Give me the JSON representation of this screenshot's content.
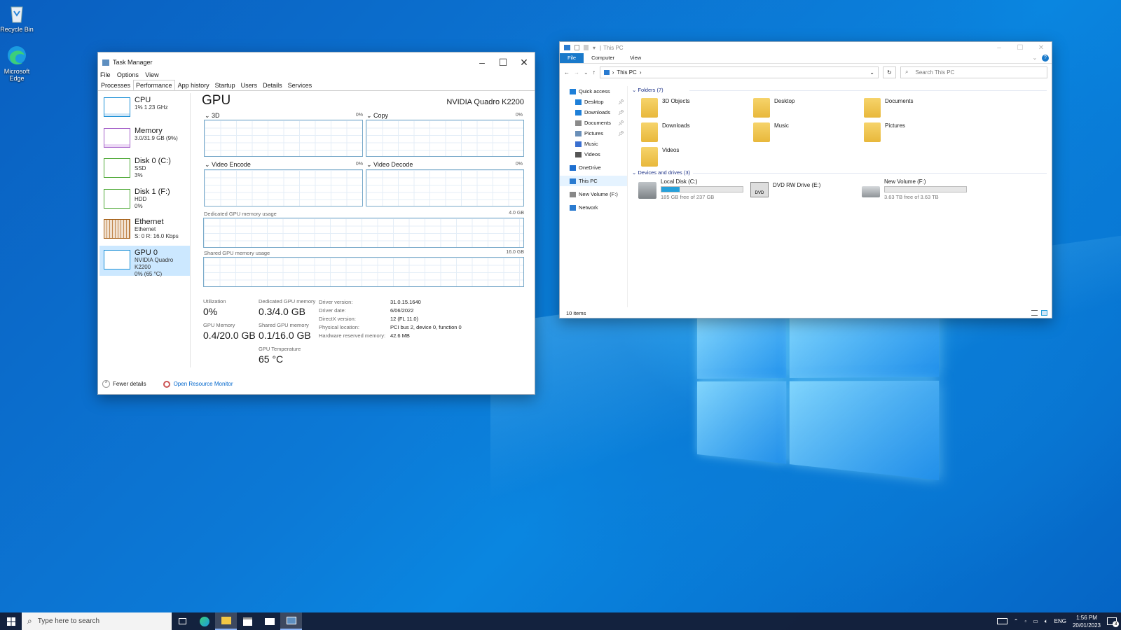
{
  "desktop": {
    "icons": [
      {
        "label": "Recycle Bin"
      },
      {
        "label": "Microsoft Edge"
      }
    ]
  },
  "task_manager": {
    "title": "Task Manager",
    "menu": [
      "File",
      "Options",
      "View"
    ],
    "tabs": [
      "Processes",
      "Performance",
      "App history",
      "Startup",
      "Users",
      "Details",
      "Services"
    ],
    "active_tab": "Performance",
    "resources": [
      {
        "name": "CPU",
        "sub1": "1% 1.23 GHz",
        "sub2": "",
        "color": "#1a8fd6"
      },
      {
        "name": "Memory",
        "sub1": "3.0/31.9 GB (9%)",
        "sub2": "",
        "color": "#a35ec8"
      },
      {
        "name": "Disk 0 (C:)",
        "sub1": "SSD",
        "sub2": "3%",
        "color": "#4da835"
      },
      {
        "name": "Disk 1 (F:)",
        "sub1": "HDD",
        "sub2": "0%",
        "color": "#4da835"
      },
      {
        "name": "Ethernet",
        "sub1": "Ethernet",
        "sub2": "S: 0 R: 16.0 Kbps",
        "color": "#a7631b"
      },
      {
        "name": "GPU 0",
        "sub1": "NVIDIA Quadro K2200",
        "sub2": "0% (65 °C)",
        "color": "#1a8fd6"
      }
    ],
    "gpu": {
      "heading": "GPU",
      "model": "NVIDIA Quadro K2200",
      "engines": [
        {
          "label": "3D",
          "pct": "0%"
        },
        {
          "label": "Copy",
          "pct": "0%"
        },
        {
          "label": "Video Encode",
          "pct": "0%"
        },
        {
          "label": "Video Decode",
          "pct": "0%"
        }
      ],
      "dedicated_label": "Dedicated GPU memory usage",
      "dedicated_max": "4.0 GB",
      "shared_label": "Shared GPU memory usage",
      "shared_max": "16.0 GB",
      "stats": [
        {
          "label": "Utilization",
          "value": "0%"
        },
        {
          "label": "Dedicated GPU memory",
          "value": "0.3/4.0 GB"
        },
        {
          "label": "GPU Memory",
          "value": "0.4/20.0 GB"
        },
        {
          "label": "Shared GPU memory",
          "value": "0.1/16.0 GB"
        },
        {
          "label": "GPU Temperature",
          "value": "65 °C"
        }
      ],
      "props": [
        {
          "k": "Driver version:",
          "v": "31.0.15.1640"
        },
        {
          "k": "Driver date:",
          "v": "6/06/2022"
        },
        {
          "k": "DirectX version:",
          "v": "12 (FL 11.0)"
        },
        {
          "k": "Physical location:",
          "v": "PCI bus 2, device 0, function 0"
        },
        {
          "k": "Hardware reserved memory:",
          "v": "42.6 MB"
        }
      ]
    },
    "footer": {
      "fewer": "Fewer details",
      "monitor": "Open Resource Monitor"
    }
  },
  "explorer": {
    "title": "This PC",
    "ribbon": [
      "File",
      "Computer",
      "View"
    ],
    "path": "This PC",
    "search_placeholder": "Search This PC",
    "nav": [
      {
        "label": "Quick access",
        "indent": 0
      },
      {
        "label": "Desktop",
        "indent": 1,
        "pin": true
      },
      {
        "label": "Downloads",
        "indent": 1,
        "pin": true
      },
      {
        "label": "Documents",
        "indent": 1,
        "pin": true
      },
      {
        "label": "Pictures",
        "indent": 1,
        "pin": true
      },
      {
        "label": "Music",
        "indent": 1
      },
      {
        "label": "Videos",
        "indent": 1
      },
      {
        "label": "OneDrive",
        "indent": 0
      },
      {
        "label": "This PC",
        "indent": 0,
        "selected": true
      },
      {
        "label": "New Volume (F:)",
        "indent": 0
      },
      {
        "label": "Network",
        "indent": 0
      }
    ],
    "folders_header": "Folders (7)",
    "folders": [
      "3D Objects",
      "Desktop",
      "Documents",
      "Downloads",
      "Music",
      "Pictures",
      "Videos"
    ],
    "drives_header": "Devices and drives (3)",
    "drives": [
      {
        "name": "Local Disk (C:)",
        "free": "185 GB free of 237 GB",
        "used_fraction": 0.22
      },
      {
        "name": "DVD RW Drive (E:)",
        "free": "",
        "used_fraction": null
      },
      {
        "name": "New Volume (F:)",
        "free": "3.63 TB free of 3.63 TB",
        "used_fraction": 0.0
      }
    ],
    "status": "10 items"
  },
  "taskbar": {
    "search_placeholder": "Type here to search",
    "lang": "ENG",
    "time": "1:56 PM",
    "date": "20/01/2023",
    "notifications": "3"
  }
}
